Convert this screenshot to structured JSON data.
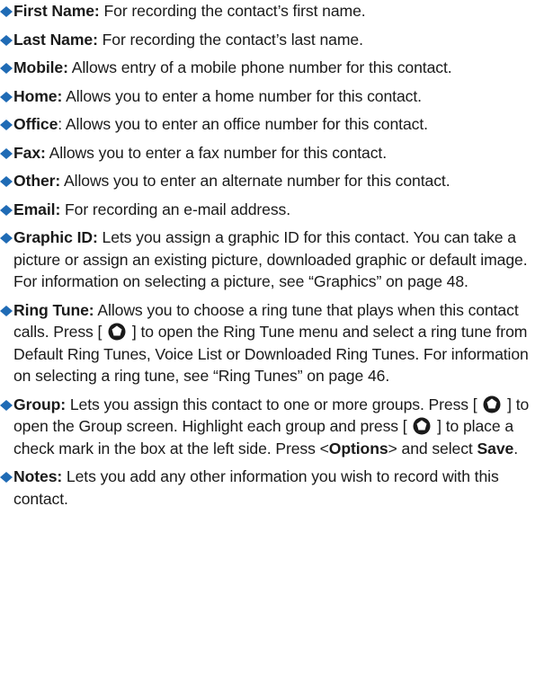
{
  "accent_color": "#1f6bb5",
  "bullet_icon": "diamond-bullet-icon",
  "key_icon": "nav-key-icon",
  "items": [
    {
      "term": "First Name:",
      "text": " For recording the contact’s first name."
    },
    {
      "term": "Last Name:",
      "text": " For recording the contact’s last name."
    },
    {
      "term": "Mobile:",
      "text": " Allows entry of a mobile phone number for this contact."
    },
    {
      "term": "Home:",
      "text": " Allows you to enter a home number for this contact."
    },
    {
      "term": "Office",
      "text": ": Allows you to enter an office number for this contact."
    },
    {
      "term": "Fax:",
      "text": " Allows you to enter a fax number for this contact."
    },
    {
      "term": "Other:",
      "text": " Allows you to enter an alternate number for this contact."
    },
    {
      "term": "Email:",
      "text": " For recording an e-mail address."
    },
    {
      "term": "Graphic ID:",
      "text": " Lets you assign a graphic ID for this contact. You can take a picture or assign an existing picture, downloaded graphic or default image. For information on selecting a picture, see “Graphics” on page 48."
    },
    {
      "term": "Ring Tune:",
      "text_a": " Allows you to choose a ring tune that plays when this contact calls. Press [ ",
      "text_b": " ] to open the Ring Tune menu and select a ring tune from Default Ring Tunes, Voice List or Downloaded Ring Tunes. For information on selecting a ring tune, see “Ring Tunes” on page 46."
    },
    {
      "term": "Group:",
      "text_a": " Lets you assign this contact to one or more groups. Press [ ",
      "text_b": " ] to open the Group screen. Highlight each group and press [ ",
      "text_c": " ] to place a check mark in the box at the left side. Press <",
      "options": "Options",
      "text_d": "> and select ",
      "save": "Save",
      "text_e": "."
    },
    {
      "term": "Notes:",
      "text": " Lets you add any other information you wish to record with this contact."
    }
  ]
}
